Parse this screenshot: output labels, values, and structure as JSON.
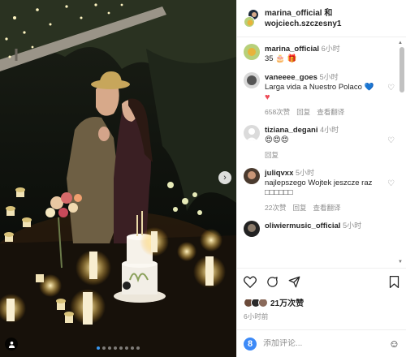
{
  "header": {
    "user1": "marina_official",
    "joiner": "和",
    "user2": "wojciech.szczesny1"
  },
  "caption": {
    "username": "marina_official",
    "time": "6小时",
    "text": "35 🎂 🎁"
  },
  "comments": [
    {
      "username": "vaneeee_goes",
      "time": "5小时",
      "text": "Larga vida a Nuestro Polaco 💙",
      "extra": "♥",
      "likes": "658次赞",
      "reply": "回复",
      "translate": "查看翻译"
    },
    {
      "username": "tiziana_degani",
      "time": "4小时",
      "text": "😍😍😍",
      "reply": "回复"
    },
    {
      "username": "juliqvxx",
      "time": "5小时",
      "text": "najlepszego Wojtek jeszcze raz □□□□□□",
      "likes": "22次赞",
      "reply": "回复",
      "translate": "查看翻译"
    },
    {
      "username": "oliwiermusic_official",
      "time": "5小时"
    }
  ],
  "actions": {
    "likes_count": "21万次赞",
    "time_ago": "6小时前"
  },
  "add_comment": {
    "placeholder": "添加评论..."
  },
  "icons": {
    "next": "chevron-right-icon",
    "tag": "person-icon",
    "like": "heart-icon",
    "comment": "comment-icon",
    "share": "send-icon",
    "save": "bookmark-icon",
    "emoji": "smile-icon"
  },
  "colors": {
    "accent": "#3897f0",
    "muted": "#8e8e8e",
    "text": "#262626",
    "like_red": "#ed4956"
  }
}
